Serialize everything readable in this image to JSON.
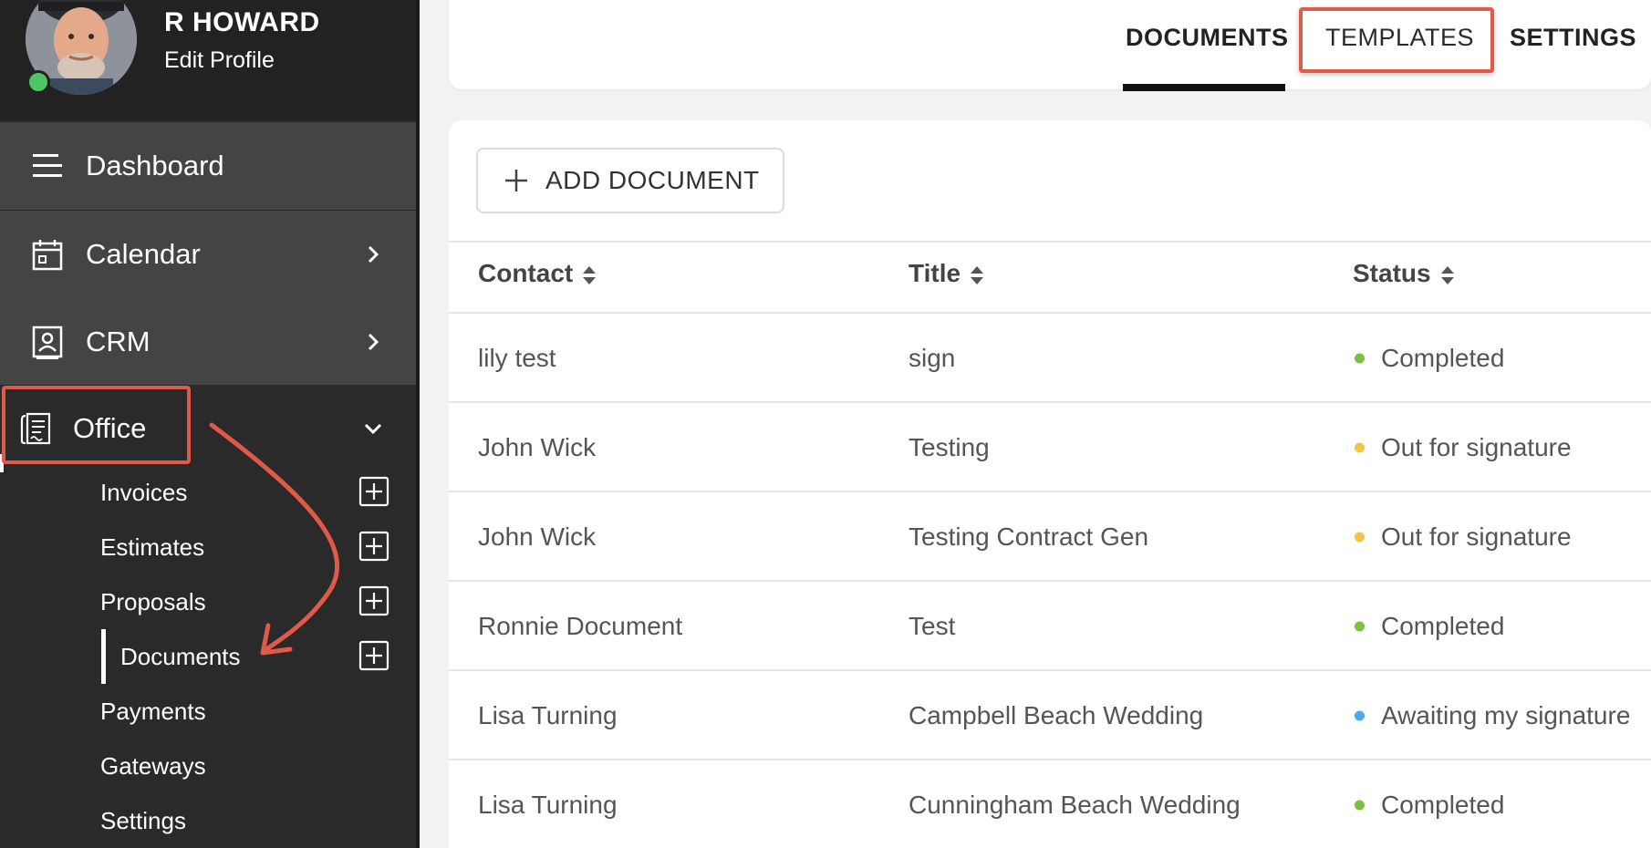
{
  "profile": {
    "name": "R HOWARD",
    "edit_label": "Edit Profile"
  },
  "nav": {
    "dashboard": "Dashboard",
    "calendar": "Calendar",
    "crm": "CRM",
    "office": "Office"
  },
  "office_menu": {
    "invoices": "Invoices",
    "estimates": "Estimates",
    "proposals": "Proposals",
    "documents": "Documents",
    "payments": "Payments",
    "gateways": "Gateways",
    "settings": "Settings"
  },
  "tabs": {
    "documents": "DOCUMENTS",
    "templates": "TEMPLATES",
    "settings": "SETTINGS"
  },
  "add_button": "ADD DOCUMENT",
  "table": {
    "headers": {
      "contact": "Contact",
      "title": "Title",
      "status": "Status"
    },
    "rows": [
      {
        "contact": "lily test",
        "title": "sign",
        "status": "Completed",
        "status_color": "#7bc043"
      },
      {
        "contact": "John Wick",
        "title": "Testing",
        "status": "Out for signature",
        "status_color": "#f5c243"
      },
      {
        "contact": "John Wick",
        "title": "Testing Contract Gen",
        "status": "Out for signature",
        "status_color": "#f5c243"
      },
      {
        "contact": "Ronnie Document",
        "title": "Test",
        "status": "Completed",
        "status_color": "#7bc043"
      },
      {
        "contact": "Lisa Turning",
        "title": "Campbell Beach Wedding",
        "status": "Awaiting my signature",
        "status_color": "#4aa8f0"
      },
      {
        "contact": "Lisa Turning",
        "title": "Cunningham Beach Wedding",
        "status": "Completed",
        "status_color": "#7bc043"
      }
    ]
  },
  "colors": {
    "highlight": "#e05a4a",
    "sidebar": "#2a2a2a",
    "nav_active": "#444444",
    "online": "#4cc764"
  },
  "icons": {
    "dashboard": "menu-lines-icon",
    "calendar": "calendar-icon",
    "crm": "contact-card-icon",
    "office": "office-document-icon",
    "expand": "chevron-right-icon",
    "collapse": "chevron-down-icon",
    "add": "plus-box-icon",
    "sort": "sort-icon"
  }
}
